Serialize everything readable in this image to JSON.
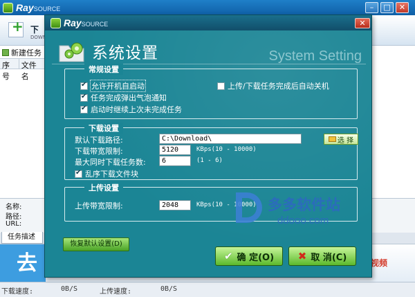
{
  "main": {
    "logo_text": "Ray",
    "logo_sub": "SOURCE",
    "minimize": "–",
    "maximize": "□",
    "close": "✕",
    "toolbar_btn": "下",
    "toolbar_btn_sub": "DOWN",
    "new_task": "新建任务",
    "col_index": "序号",
    "col_file": "文件名",
    "info_name": "名称:",
    "info_path": "路径:",
    "info_url": "URL:",
    "info_tab": "任务描述",
    "banner_left": "去",
    "banner_right": "视频"
  },
  "statusbar": {
    "download_label": "下载速度:",
    "download_value": "0B/S",
    "upload_label": "上传速度:",
    "upload_value": "0B/S"
  },
  "dialog": {
    "logo_text": "Ray",
    "logo_sub": "SOURCE",
    "close": "✕",
    "title": "系统设置",
    "subtitle": "System Setting",
    "general": {
      "title": "常规设置",
      "autostart": "允许开机自启动",
      "autostart_checked": true,
      "notify": "任务完成弹出气泡通知",
      "notify_checked": true,
      "resume": "启动时继续上次未完成任务",
      "resume_checked": true,
      "shutdown": "上传/下载任务完成后自动关机",
      "shutdown_checked": false
    },
    "download": {
      "title": "下载设置",
      "path_label": "默认下载路径:",
      "path_value": "C:\\Download\\",
      "browse": "选 择",
      "bandwidth_label": "下载带宽限制:",
      "bandwidth_value": "5120",
      "bandwidth_hint": "KBps(10 - 10000)",
      "max_tasks_label": "最大同时下载任务数:",
      "max_tasks_value": "6",
      "max_tasks_hint": "(1 - 6)",
      "random_blocks": "乱序下载文件块",
      "random_blocks_checked": true
    },
    "upload": {
      "title": "上传设置",
      "bandwidth_label": "上传带宽限制:",
      "bandwidth_value": "2048",
      "bandwidth_hint": "KBps(10 - 10000)"
    },
    "restore_defaults": "恢复默认设置(D)",
    "ok": "确 定(O)",
    "cancel": "取 消(C)"
  },
  "watermark": {
    "cn": "多多软件站",
    "en": "ddooo.com"
  },
  "colors": {
    "dialog_bg": "#1b8595",
    "button_green": "#5cb92c",
    "titlebar_blue": "#0f5fa6"
  }
}
